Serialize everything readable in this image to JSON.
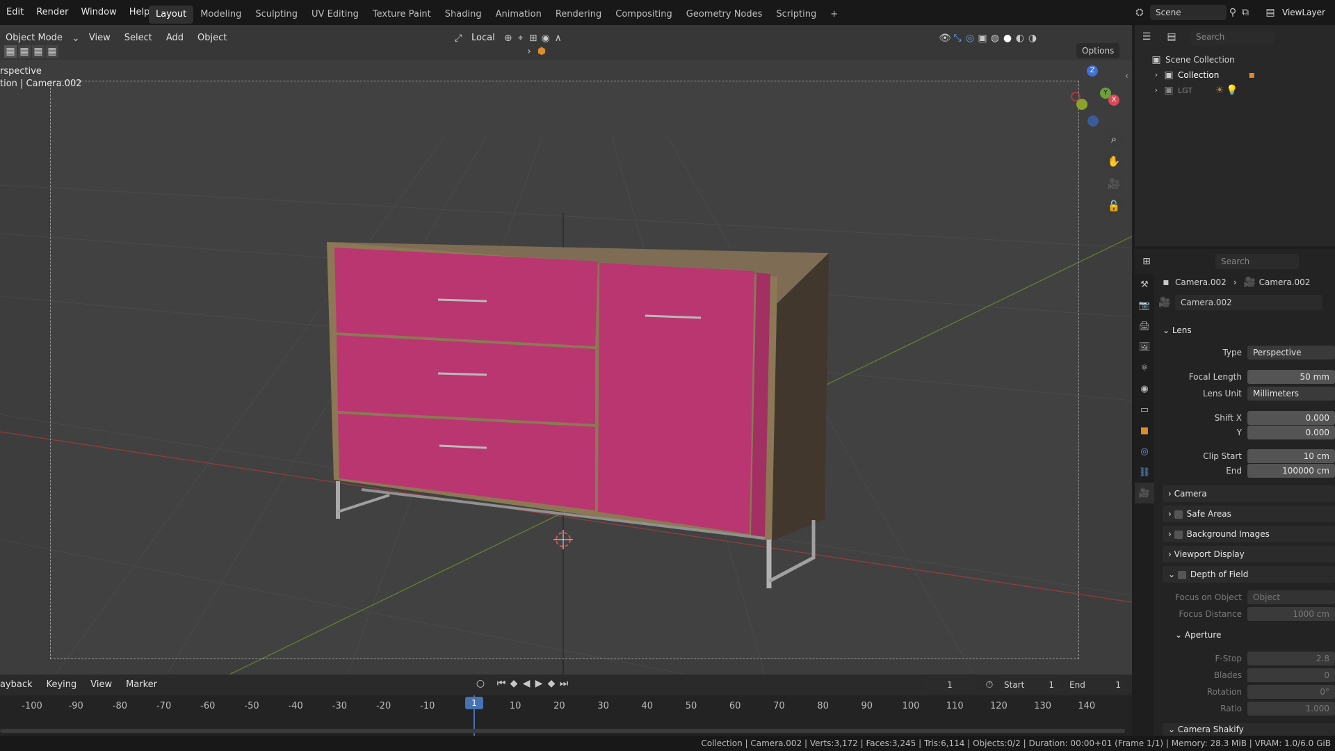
{
  "menu": [
    "Edit",
    "Render",
    "Window",
    "Help"
  ],
  "workspaces": [
    "Layout",
    "Modeling",
    "Sculpting",
    "UV Editing",
    "Texture Paint",
    "Shading",
    "Animation",
    "Rendering",
    "Compositing",
    "Geometry Nodes",
    "Scripting"
  ],
  "workspace_add": "+",
  "scene_name": "Scene",
  "view_layer": "ViewLayer",
  "viewport": {
    "mode": "Object Mode",
    "menu": [
      "View",
      "Select",
      "Add",
      "Object"
    ],
    "transform_orientation": "Local",
    "options_label": "Options",
    "overlay_line1": "rspective",
    "overlay_line2": "tion | Camera.002",
    "axis_labels": {
      "z": "Z",
      "y": "Y",
      "x": "X"
    }
  },
  "outliner": {
    "search_placeholder": "Search",
    "scene_collection": "Scene Collection",
    "items": [
      "Collection",
      "LGT"
    ]
  },
  "properties": {
    "search_placeholder": "Search",
    "breadcrumb_object": "Camera.002",
    "breadcrumb_data": "Camera.002",
    "datablock": "Camera.002",
    "lens_panel": "Lens",
    "type_label": "Type",
    "type_value": "Perspective",
    "focal_label": "Focal Length",
    "focal_value": "50 mm",
    "lens_unit_label": "Lens Unit",
    "lens_unit_value": "Millimeters",
    "shift_x_label": "Shift X",
    "shift_x_value": "0.000",
    "shift_y_label": "Y",
    "shift_y_value": "0.000",
    "clip_start_label": "Clip Start",
    "clip_start_value": "10 cm",
    "clip_end_label": "End",
    "clip_end_value": "100000 cm",
    "panels": [
      "Camera",
      "Safe Areas",
      "Background Images",
      "Viewport Display",
      "Depth of Field"
    ],
    "focus_obj_label": "Focus on Object",
    "focus_obj_value": "Object",
    "focus_dist_label": "Focus Distance",
    "focus_dist_value": "1000 cm",
    "aperture_panel": "Aperture",
    "fstop_label": "F-Stop",
    "fstop_value": "2.8",
    "blades_label": "Blades",
    "blades_value": "0",
    "rotation_label": "Rotation",
    "rotation_value": "0°",
    "ratio_label": "Ratio",
    "ratio_value": "1.000",
    "shakify_panel": "Camera Shakify"
  },
  "timeline": {
    "menu": [
      "ayback",
      "Keying",
      "View",
      "Marker"
    ],
    "current_frame": "1",
    "start_label": "Start",
    "start_value": "1",
    "end_label": "End",
    "end_value": "1",
    "ticks": [
      "-100",
      "-90",
      "-80",
      "-70",
      "-60",
      "-50",
      "-40",
      "-30",
      "-20",
      "-10",
      "1",
      "10",
      "20",
      "30",
      "40",
      "50",
      "60",
      "70",
      "80",
      "90",
      "100",
      "110",
      "120",
      "130",
      "140"
    ],
    "playhead": "1"
  },
  "status": "Collection | Camera.002 | Verts:3,172 | Faces:3,245 | Tris:6,114 | Objects:0/2 | Duration: 00:00+01 (Frame 1/1) | Memory: 28.3 MiB | VRAM: 1.0/6.0 GiB",
  "colors": {
    "accent": "#4772b3",
    "cabinet_front": "#b8326e",
    "cabinet_body": "#3d3328",
    "frame": "#8a7550"
  }
}
